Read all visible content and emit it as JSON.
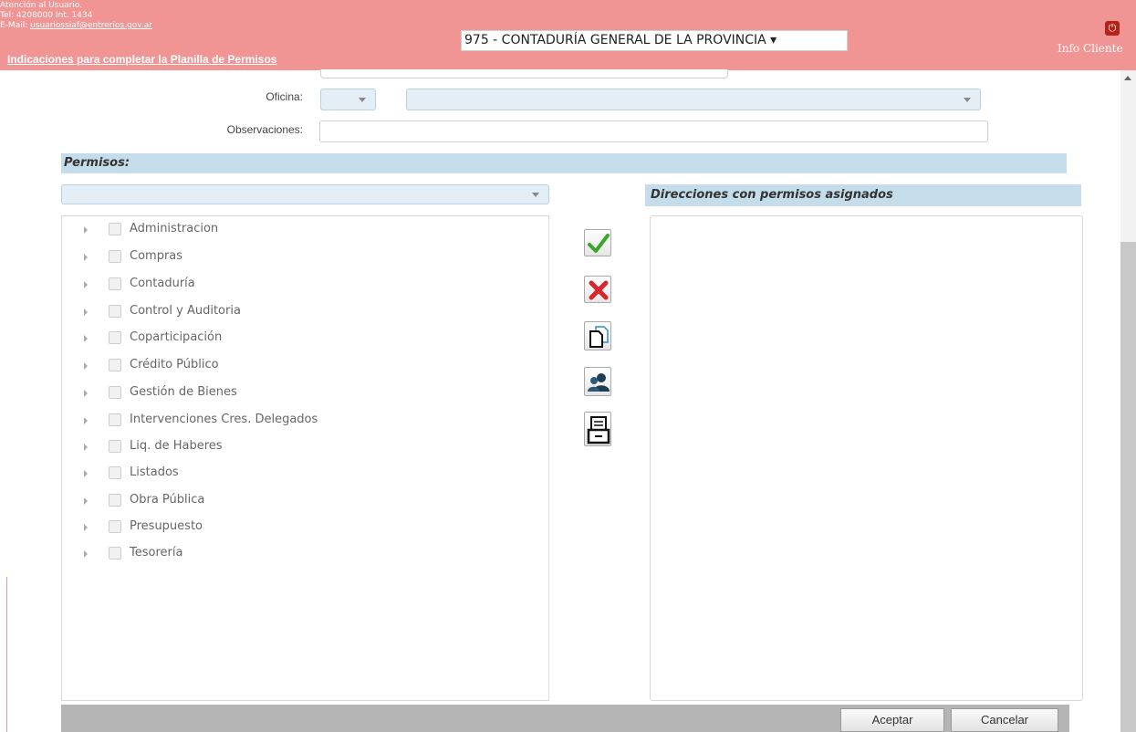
{
  "header": {
    "contact_line1": "Atención al Usuario.",
    "contact_line2": "Tel: 4208000 Int. 1434",
    "email_prefix": "E-Mail: ",
    "email": "usuariossiaf@entrerios.gov.ar",
    "instructions_link": "Indicaciones para completar la Planilla de Permisos",
    "organization": "975 - CONTADURÍA GENERAL DE LA PROVINCIA ▾",
    "power_icon": "power-icon",
    "info_cliente": "Info Cliente",
    "color": "#f09494"
  },
  "form": {
    "oficina_label": "Oficina:",
    "observaciones_label": "Observaciones:"
  },
  "permisos": {
    "title": "Permisos:",
    "modules": [
      "Administracion",
      "Compras",
      "Contaduría",
      "Control y Auditoria",
      "Coparticipación",
      "Crédito Público",
      "Gestión de Bienes",
      "Intervenciones Cres. Delegados",
      "Liq. de Haberes",
      "Listados",
      "Obra Pública",
      "Presupuesto",
      "Tesorería"
    ]
  },
  "actions": {
    "icons": [
      "check-icon",
      "delete-icon",
      "copy-document-icon",
      "users-icon",
      "print-icon"
    ]
  },
  "assigned": {
    "title": "Direcciones con permisos asignados"
  },
  "footer": {
    "accept_label": "Aceptar",
    "cancel_label": "Cancelar"
  }
}
